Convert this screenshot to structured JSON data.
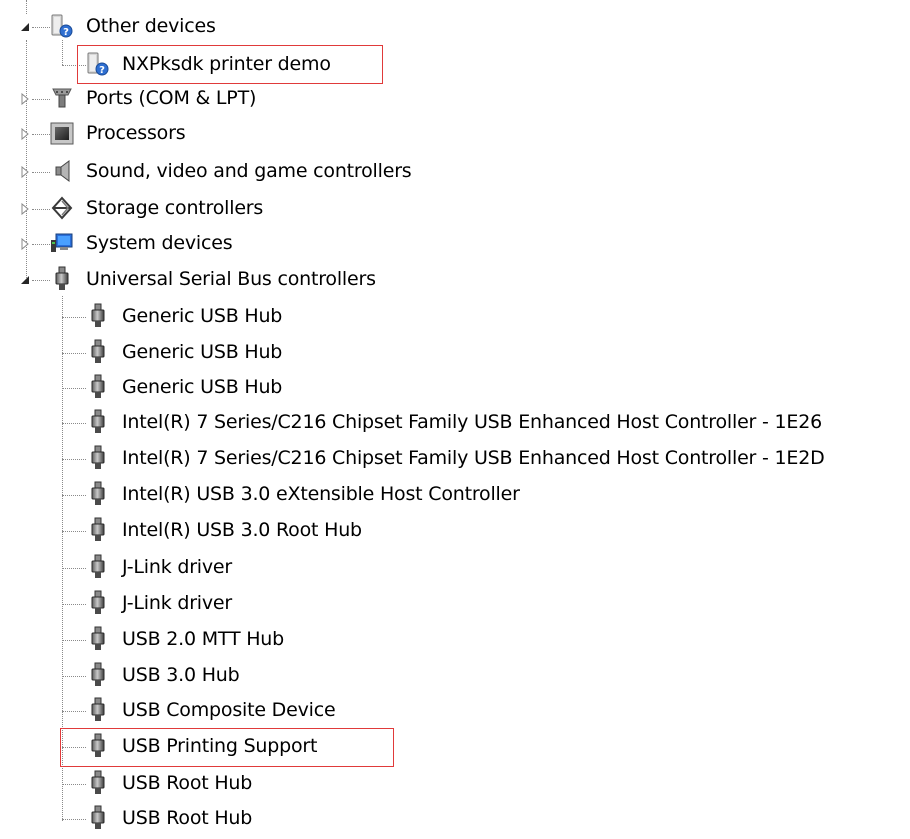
{
  "tree": {
    "categories": [
      {
        "label": "Other devices",
        "icon": "unknown-device-icon",
        "expanded": true
      },
      {
        "label": "Ports (COM & LPT)",
        "icon": "port-icon",
        "expanded": false
      },
      {
        "label": "Processors",
        "icon": "processor-icon",
        "expanded": false
      },
      {
        "label": "Sound, video and game controllers",
        "icon": "speaker-icon",
        "expanded": false
      },
      {
        "label": "Storage controllers",
        "icon": "storage-icon",
        "expanded": false
      },
      {
        "label": "System devices",
        "icon": "computer-icon",
        "expanded": false
      },
      {
        "label": "Universal Serial Bus controllers",
        "icon": "usb-plug-icon",
        "expanded": true
      }
    ],
    "other_devices_children": [
      {
        "label": "NXPksdk printer demo",
        "icon": "unknown-device-icon",
        "highlighted": true
      }
    ],
    "usb_children": [
      {
        "label": "Generic USB Hub",
        "icon": "usb-plug-icon"
      },
      {
        "label": "Generic USB Hub",
        "icon": "usb-plug-icon"
      },
      {
        "label": "Generic USB Hub",
        "icon": "usb-plug-icon"
      },
      {
        "label": "Intel(R) 7 Series/C216 Chipset Family USB Enhanced Host Controller - 1E26",
        "icon": "usb-plug-icon"
      },
      {
        "label": "Intel(R) 7 Series/C216 Chipset Family USB Enhanced Host Controller - 1E2D",
        "icon": "usb-plug-icon"
      },
      {
        "label": "Intel(R) USB 3.0 eXtensible Host Controller",
        "icon": "usb-plug-icon"
      },
      {
        "label": "Intel(R) USB 3.0 Root Hub",
        "icon": "usb-plug-icon"
      },
      {
        "label": "J-Link driver",
        "icon": "usb-plug-icon"
      },
      {
        "label": "J-Link driver",
        "icon": "usb-plug-icon"
      },
      {
        "label": "USB 2.0 MTT Hub",
        "icon": "usb-plug-icon"
      },
      {
        "label": "USB 3.0 Hub",
        "icon": "usb-plug-icon"
      },
      {
        "label": "USB Composite Device",
        "icon": "usb-plug-icon"
      },
      {
        "label": "USB Printing Support",
        "icon": "usb-plug-icon",
        "highlighted": true
      },
      {
        "label": "USB Root Hub",
        "icon": "usb-plug-icon"
      },
      {
        "label": "USB Root Hub",
        "icon": "usb-plug-icon"
      }
    ]
  },
  "colors": {
    "highlight_border": "#e03a3a",
    "connector": "#8a8a8a"
  }
}
